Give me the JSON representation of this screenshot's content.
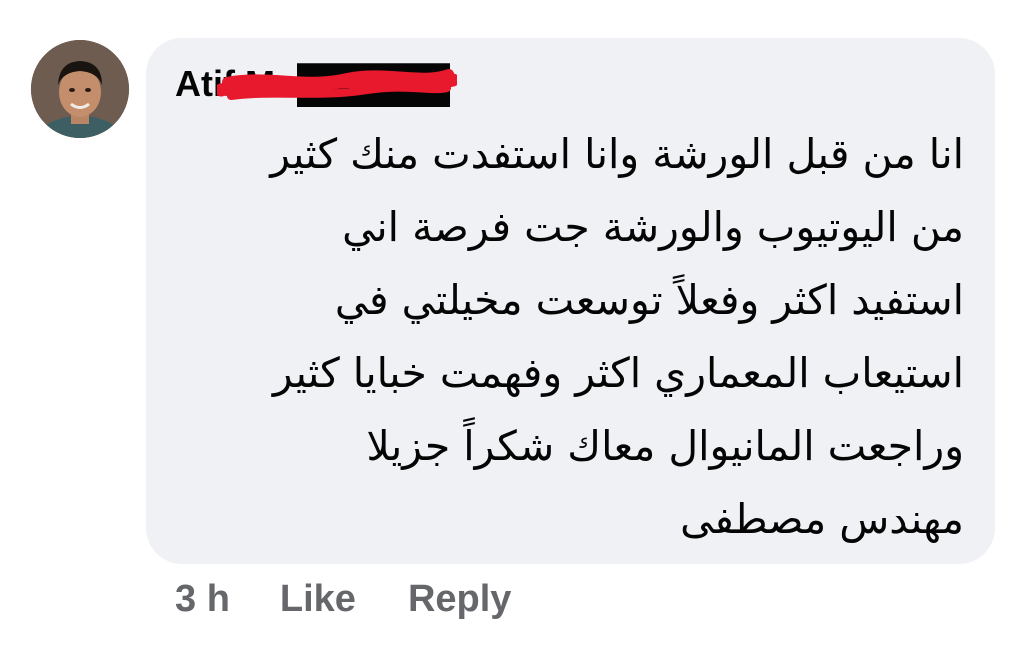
{
  "comment": {
    "author": {
      "name": "Atif Mo██████",
      "avatar": "profile-photo"
    },
    "text_lines": [
      "انا من قبل الورشة وانا استفدت منك كثير",
      "من اليوتيوب والورشة جت فرصة اني",
      "استفيد اكثر وفعلاً توسعت مخيلتي في",
      "استيعاب المعماري اكثر وفهمت خبايا كثير",
      "وراجعت المانيوال معاك شكراً جزيلا",
      "مهندس مصطفى"
    ],
    "timestamp": "3 h",
    "actions": {
      "like_label": "Like",
      "reply_label": "Reply"
    }
  },
  "colors": {
    "bubble_background": "#eff1f4",
    "text_primary": "#050505",
    "text_secondary": "#65676b",
    "redaction_marker": "#e8192c"
  }
}
